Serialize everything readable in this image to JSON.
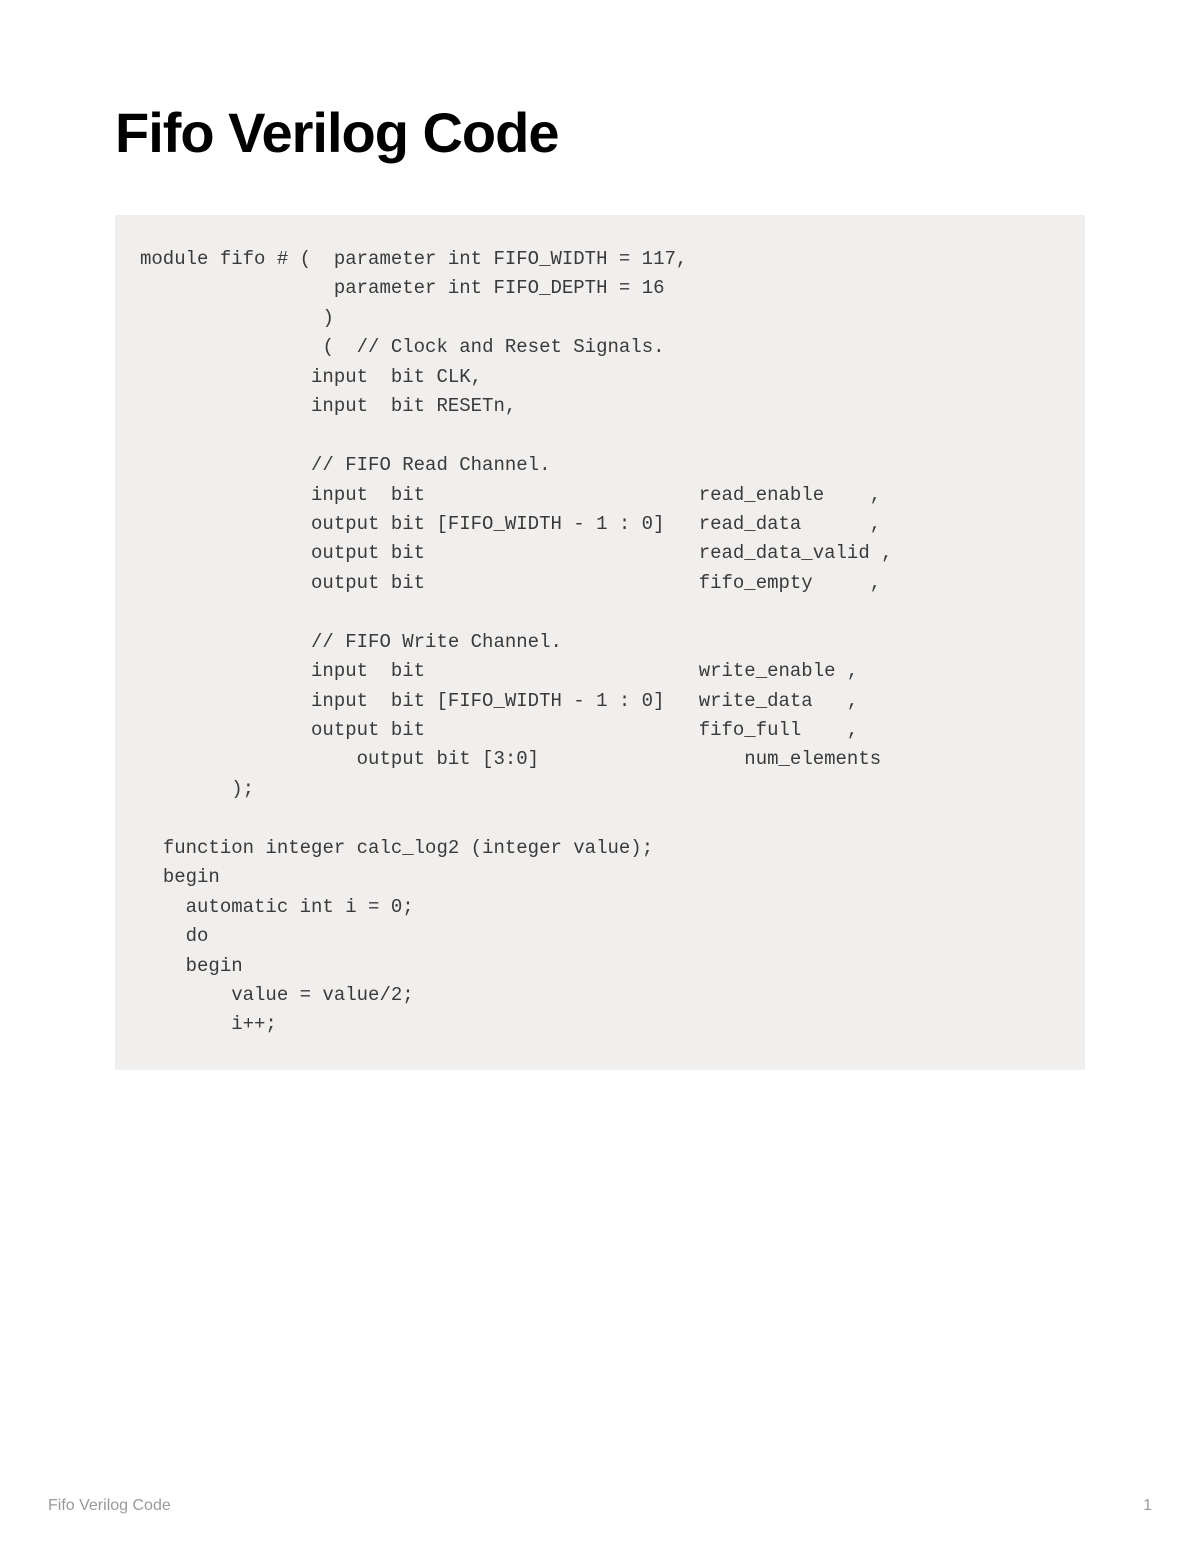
{
  "title": "Fifo Verilog Code",
  "code": "module fifo # (  parameter int FIFO_WIDTH = 117,\n                 parameter int FIFO_DEPTH = 16\n                )\n                (  // Clock and Reset Signals.\n               input  bit CLK,\n               input  bit RESETn,\n\n               // FIFO Read Channel.\n               input  bit                        read_enable    ,\n               output bit [FIFO_WIDTH - 1 : 0]   read_data      ,\n               output bit                        read_data_valid ,\n               output bit                        fifo_empty     ,\n\n               // FIFO Write Channel.\n               input  bit                        write_enable ,\n               input  bit [FIFO_WIDTH - 1 : 0]   write_data   ,\n               output bit                        fifo_full    ,\n                   output bit [3:0]                  num_elements\n        );\n\n  function integer calc_log2 (integer value);\n  begin\n    automatic int i = 0;\n    do\n    begin\n        value = value/2;\n        i++;",
  "footer": {
    "title": "Fifo Verilog Code",
    "page": "1"
  }
}
